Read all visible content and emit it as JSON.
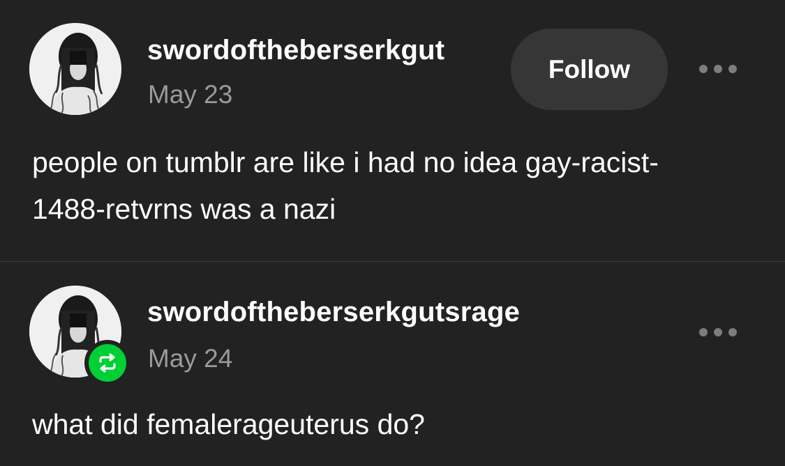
{
  "posts": [
    {
      "username": "swordoftheberserkgut",
      "date": "May 23",
      "follow_label": "Follow",
      "body": "people on tumblr are like i had no idea gay-racist-1488-retvrns was a nazi",
      "avatar_icon": "avatar-photo",
      "more_icon": "ellipsis-icon"
    },
    {
      "username": "swordoftheberserkgutsrage",
      "date": "May 24",
      "body": "what did femalerageuterus do?",
      "avatar_icon": "avatar-photo",
      "badge_icon": "reblog-icon",
      "badge_color": "#00cf35",
      "more_icon": "ellipsis-icon"
    }
  ],
  "colors": {
    "background": "#222222",
    "text": "#ffffff",
    "date": "#9a9a9a",
    "follow_bg": "#363636",
    "reblog_green": "#00cf35"
  }
}
